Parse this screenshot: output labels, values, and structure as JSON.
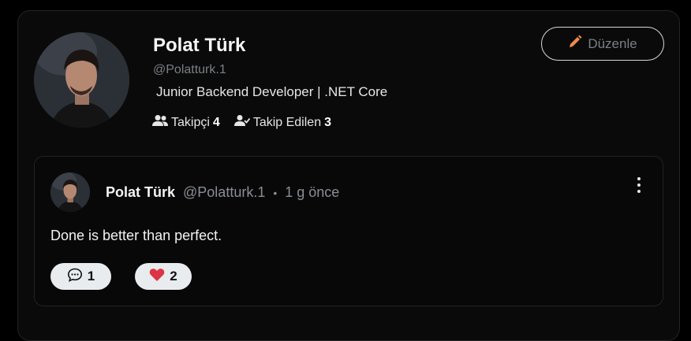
{
  "profile": {
    "name": "Polat Türk",
    "handle": "@Polatturk.1",
    "bio": "Junior Backend Developer | .NET Core",
    "followers_label": "Takipçi",
    "followers_count": "4",
    "following_label": "Takip Edilen",
    "following_count": "3",
    "edit_label": "Düzenle",
    "edit_icon": "pencil-icon"
  },
  "post": {
    "author_name": "Polat Türk",
    "author_handle": "@Polatturk.1",
    "separator": "•",
    "time": "1 g önce",
    "text": "Done is better than perfect.",
    "comment_count": "1",
    "like_count": "2",
    "comment_icon": "comment-icon",
    "like_icon": "heart-icon",
    "menu_icon": "more-vertical-icon"
  },
  "colors": {
    "background": "#000000",
    "card": "#0a0a0a",
    "muted_text": "#7b7f85",
    "pencil": "#f08a4b",
    "heart": "#dc3545",
    "pill": "#e9ecef"
  }
}
